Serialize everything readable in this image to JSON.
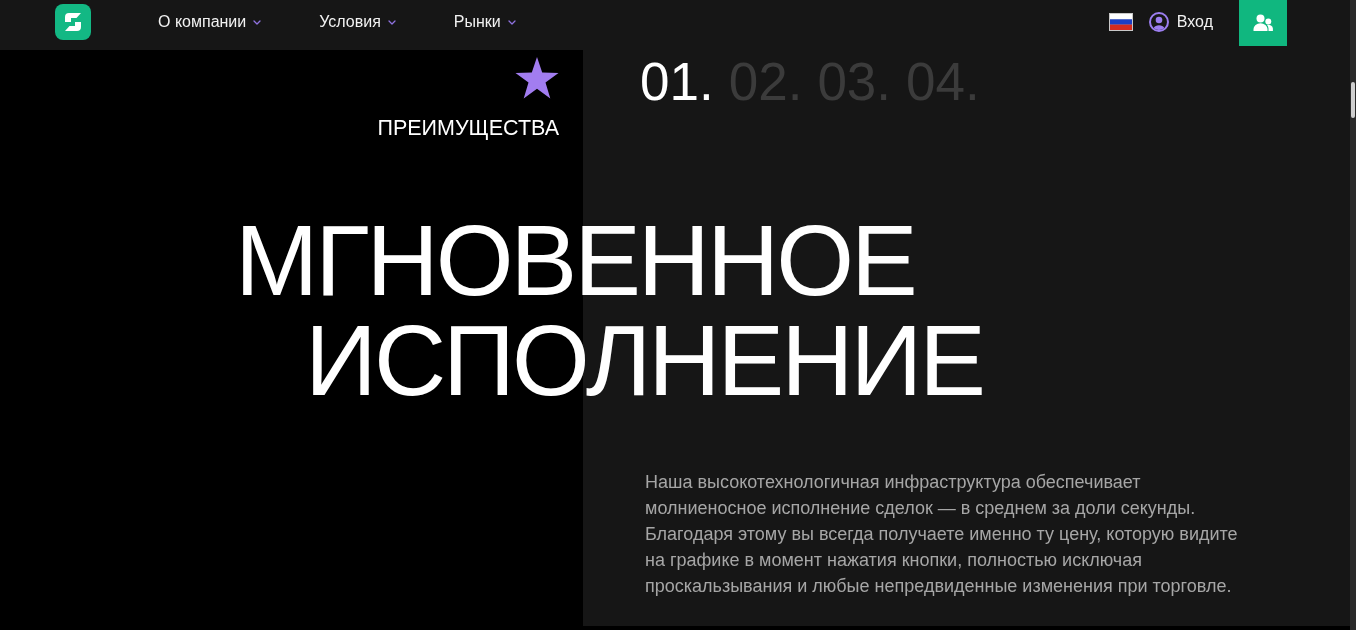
{
  "nav": {
    "menu": [
      {
        "label": "О компании"
      },
      {
        "label": "Условия"
      },
      {
        "label": "Рынки"
      }
    ],
    "login": {
      "label": "Вход"
    }
  },
  "hero": {
    "section_label": "ПРЕИМУЩЕСТВА",
    "steps": [
      {
        "label": "01.",
        "selected": true
      },
      {
        "label": "02.",
        "selected": false
      },
      {
        "label": "03.",
        "selected": false
      },
      {
        "label": "04.",
        "selected": false
      }
    ],
    "title_lines": [
      "МГНОВЕННОЕ",
      "ИСПОЛНЕНИЕ"
    ],
    "description": "Наша высокотехнологичная инфраструктура обеспечивает молниеносное исполнение сделок — в среднем за доли секунды. Благодаря этому вы всегда получаете именно ту цену, которую видите на графике в момент нажатия кнопки, полностью исключая проскальзывания и любые непредвиденные изменения при торговле."
  }
}
